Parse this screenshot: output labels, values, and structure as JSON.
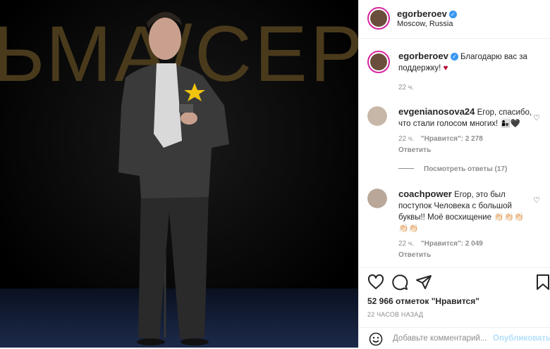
{
  "post": {
    "author": "egorberoev",
    "location": "Moscow, Russia",
    "backdrop_text": "ЬМА/СЕРИА"
  },
  "comments": [
    {
      "user": "egorberoev",
      "text": "Благодарю вас за поддержку!",
      "emoji": "♥",
      "time": "22 ч."
    },
    {
      "user": "evgenianosova24",
      "text": "Егор, спасибо, что стали голосом многих!",
      "emoji": "👩‍👧🖤",
      "time": "22 ч.",
      "likes": "\"Нравится\": 2 278",
      "reply": "Ответить"
    },
    {
      "user": "coachpower",
      "text": "Егор, это был поступок Человека с большой буквы!! Моё восхищение",
      "emoji": "👏🏻👏🏻👏🏻 👏🏻👏🏻",
      "time": "22 ч.",
      "likes": "\"Нравится\": 2 049",
      "reply": "Ответить"
    }
  ],
  "view_replies": "Посмотреть ответы (17)",
  "likes_count": "52 966 отметок \"Нравится\"",
  "post_time": "22 ЧАСОВ НАЗАД",
  "add_comment": {
    "placeholder": "Добавьте комментарий...",
    "publish": "Опубликовать"
  },
  "icons": [
    "heart-icon",
    "comment-icon",
    "share-icon",
    "bookmark-icon",
    "emoji-icon"
  ],
  "colors": {
    "verified": "#3897f0",
    "ring": "#d6249f",
    "publish_disabled": "#b2dffc",
    "heart_red": "#b5002f"
  }
}
